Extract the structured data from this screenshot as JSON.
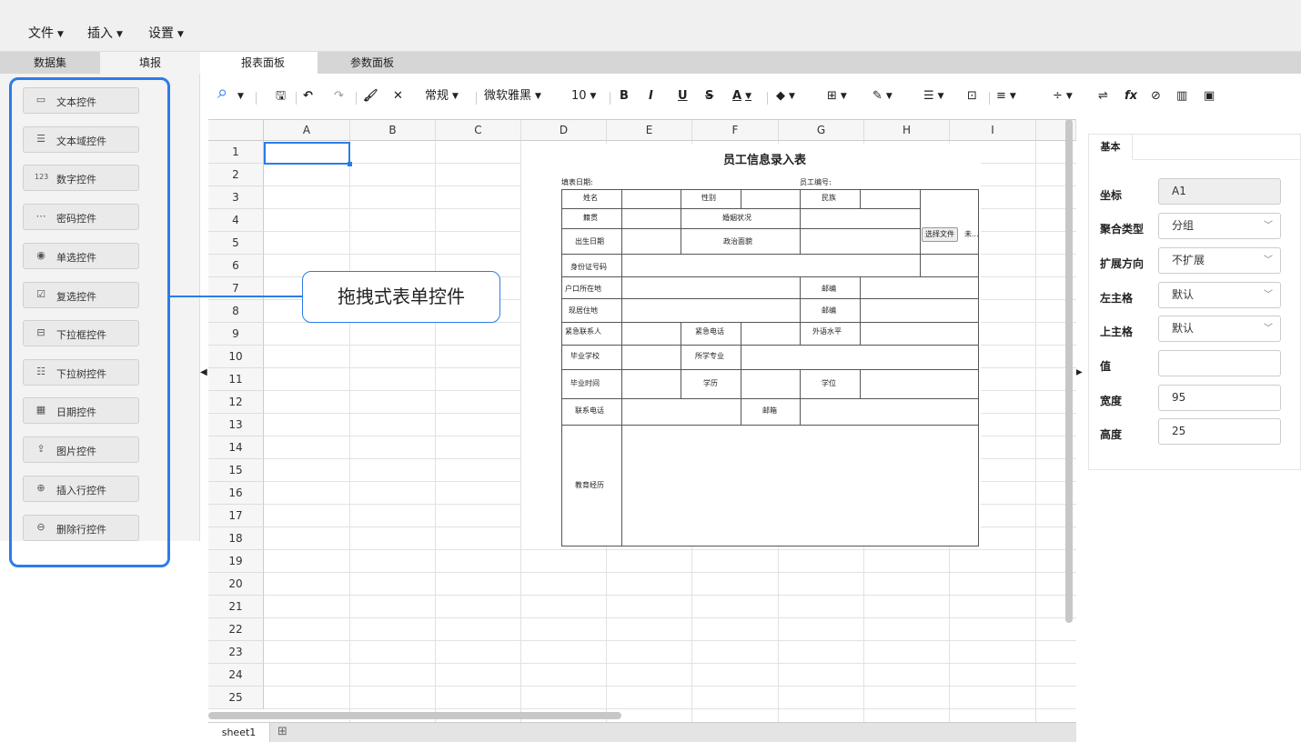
{
  "menu": {
    "file": "文件",
    "insert": "插入",
    "settings": "设置"
  },
  "left_tabs": {
    "dataset": "数据集",
    "fill": "填报"
  },
  "controls": [
    {
      "label": "文本控件",
      "icon": "text-field-icon"
    },
    {
      "label": "文本域控件",
      "icon": "textarea-icon"
    },
    {
      "label": "数字控件",
      "icon": "number-field-icon"
    },
    {
      "label": "密码控件",
      "icon": "password-field-icon"
    },
    {
      "label": "单选控件",
      "icon": "radio-icon"
    },
    {
      "label": "复选控件",
      "icon": "checkbox-icon"
    },
    {
      "label": "下拉框控件",
      "icon": "dropdown-icon"
    },
    {
      "label": "下拉树控件",
      "icon": "tree-dropdown-icon"
    },
    {
      "label": "日期控件",
      "icon": "calendar-icon"
    },
    {
      "label": "图片控件",
      "icon": "upload-icon"
    },
    {
      "label": "插入行控件",
      "icon": "plus-circle-icon"
    },
    {
      "label": "删除行控件",
      "icon": "minus-circle-icon"
    }
  ],
  "sheet_tabs": {
    "report": "报表面板",
    "params": "参数面板"
  },
  "toolbar": {
    "number_format": "常规",
    "font": "微软雅黑",
    "font_size": "10",
    "fx": "fx"
  },
  "columns": [
    "A",
    "B",
    "C",
    "D",
    "E",
    "F",
    "G",
    "H",
    "I"
  ],
  "rows": [
    "1",
    "2",
    "3",
    "4",
    "5",
    "6",
    "7",
    "8",
    "9",
    "10",
    "11",
    "12",
    "13",
    "14",
    "15",
    "16",
    "17",
    "18",
    "19",
    "20",
    "21",
    "22",
    "23",
    "24",
    "25"
  ],
  "form": {
    "title": "员工信息录入表",
    "fill_date": "填表日期:",
    "emp_no": "员工编号:",
    "name": "姓名",
    "gender": "性别",
    "ethnicity": "民族",
    "native_place": "籍贯",
    "marital": "婚姻状况",
    "birth": "出生日期",
    "political": "政治面貌",
    "id_no": "身份证号码",
    "household": "户口所在地",
    "postcode1": "邮编",
    "residence": "现居住地",
    "postcode2": "邮编",
    "emergency_contact": "紧急联系人",
    "emergency_phone": "紧急电话",
    "language": "外语水平",
    "school": "毕业学校",
    "major": "所学专业",
    "grad_time": "毕业时间",
    "education": "学历",
    "degree": "学位",
    "phone": "联系电话",
    "email": "邮箱",
    "edu_history": "教育经历",
    "choose_file": "选择文件",
    "no_file": "未..."
  },
  "callout": "拖拽式表单控件",
  "props": {
    "tab": "基本",
    "coord_label": "坐标",
    "coord_value": "A1",
    "agg_label": "聚合类型",
    "agg_value": "分组",
    "expand_label": "扩展方向",
    "expand_value": "不扩展",
    "left_label": "左主格",
    "left_value": "默认",
    "top_label": "上主格",
    "top_value": "默认",
    "value_label": "值",
    "value_value": "",
    "width_label": "宽度",
    "width_value": "95",
    "height_label": "高度",
    "height_value": "25"
  },
  "bottom": {
    "sheet1": "sheet1"
  }
}
